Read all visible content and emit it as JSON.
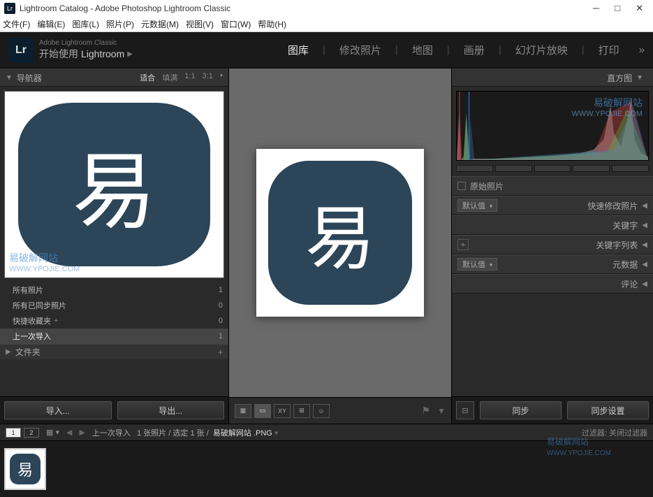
{
  "window": {
    "title": "Lightroom Catalog - Adobe Photoshop Lightroom Classic",
    "logo_short": "Lr"
  },
  "menu": [
    "文件(F)",
    "编辑(E)",
    "图库(L)",
    "照片(P)",
    "元数据(M)",
    "视图(V)",
    "窗口(W)",
    "帮助(H)"
  ],
  "brand": {
    "line1": "Adobe Lightroom Classic",
    "line2_prefix": "开始使用",
    "line2_word": "Lightroom"
  },
  "modules": {
    "items": [
      "图库",
      "修改照片",
      "地图",
      "画册",
      "幻灯片放映",
      "打印"
    ],
    "active": "图库"
  },
  "navigator": {
    "title": "导航器",
    "zoom": [
      "适合",
      "填满",
      "1:1",
      "3:1"
    ],
    "zoom_active": "适合"
  },
  "catalog": {
    "rows": [
      {
        "label": "所有照片",
        "count": "1"
      },
      {
        "label": "所有已同步照片",
        "count": "0"
      },
      {
        "label": "快捷收藏夹",
        "plus": "+",
        "count": "0"
      },
      {
        "label": "上一次导入",
        "count": "1",
        "selected": true
      }
    ]
  },
  "folders": {
    "title": "文件夹"
  },
  "io": {
    "import": "导入...",
    "export": "导出..."
  },
  "image_char": "易",
  "right": {
    "histogram": "直方图",
    "original": "原始照片",
    "quick_default": "默认值",
    "quick": "快速修改照片",
    "keywords": "关键字",
    "keyword_list": "关键字列表",
    "metadata_default": "默认值",
    "metadata": "元数据",
    "comments": "评论",
    "sync": "同步",
    "sync_settings": "同步设置"
  },
  "toolbar": {
    "xy": "XY",
    "flag": "⚑"
  },
  "filmstrip": {
    "screens": [
      "1",
      "2"
    ],
    "path_label": "上一次导入",
    "count": "1 张照片 / 选定 1 张 /",
    "filename": "易破解网站 .PNG",
    "filter_label": "过滤器:",
    "filter_value": "关闭过滤器"
  },
  "watermark": {
    "text": "易破解网站",
    "url": "WWW.YPOJIE.COM"
  }
}
